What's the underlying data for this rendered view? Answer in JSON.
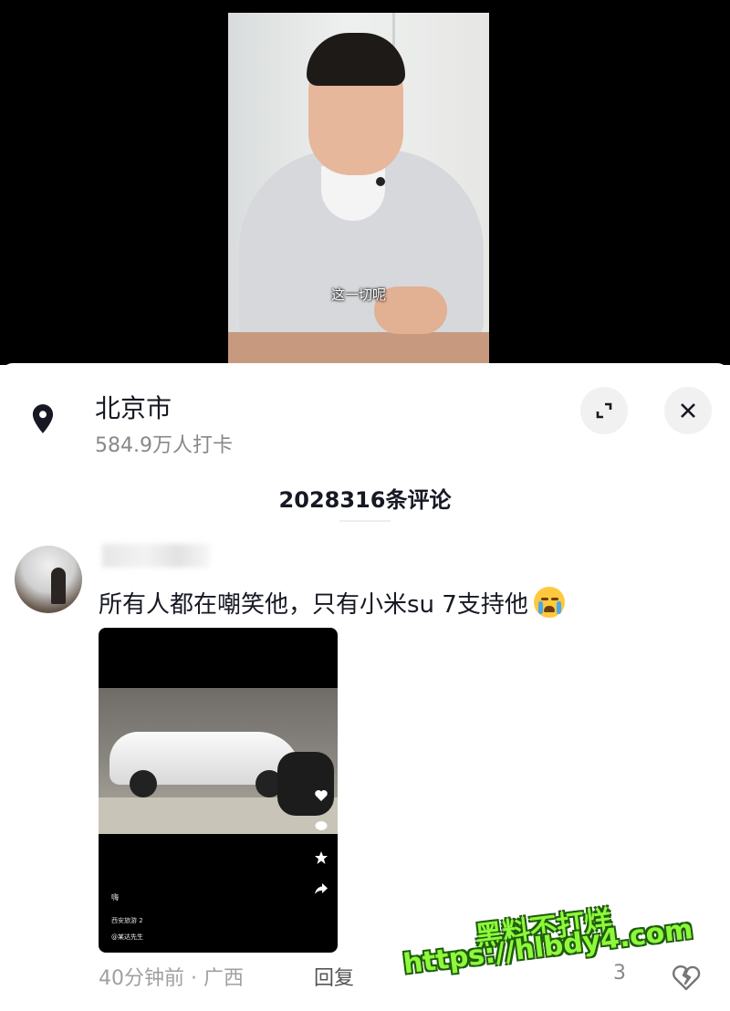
{
  "video": {
    "subtitle": "这一切呢"
  },
  "location": {
    "name": "北京市",
    "checkins": "584.9万人打卡"
  },
  "comments_header": {
    "count_label": "2028316条评论"
  },
  "comment": {
    "text": "所有人都在嘲笑他，只有小米su 7支持他",
    "emoji": "loudly-crying-face",
    "time_location": "40分钟前 · 广西",
    "reply_label": "回复",
    "like_count": "3",
    "attachment": {
      "caption": "嗨",
      "tag": "西安旅游 2",
      "author": "@某达先生"
    }
  },
  "watermark": {
    "line1": "黑料不打烊",
    "line2": "https://hlbdy4.com"
  },
  "colors": {
    "watermark_fill": "#8ef83a",
    "watermark_stroke": "#1f5d0d",
    "text_primary": "#161823",
    "text_secondary": "#a0a0a0"
  }
}
